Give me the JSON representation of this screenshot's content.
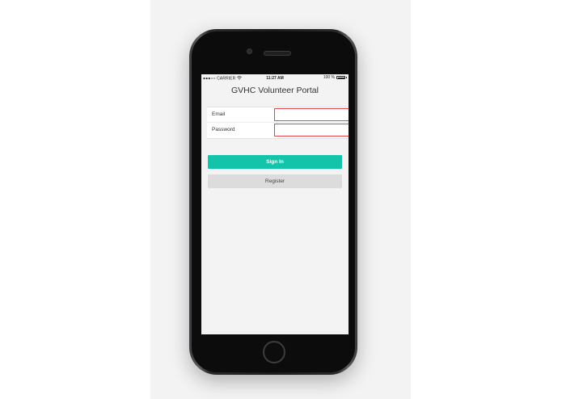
{
  "status_bar": {
    "carrier": "●●●○○ CARRIER",
    "wifi_icon": "wifi-icon",
    "time": "11:27 AM",
    "battery_percent": "100 %",
    "battery_level": 1.0
  },
  "app": {
    "title": "GVHC Volunteer Portal"
  },
  "form": {
    "email_label": "Email",
    "email_value": "",
    "password_label": "Password",
    "password_value": ""
  },
  "buttons": {
    "sign_in": "Sign In",
    "register": "Register"
  },
  "colors": {
    "accent": "#13c3aa",
    "error_border": "#e0454a",
    "secondary_button": "#dcdcdc",
    "screen_background": "#f3f3f3"
  }
}
